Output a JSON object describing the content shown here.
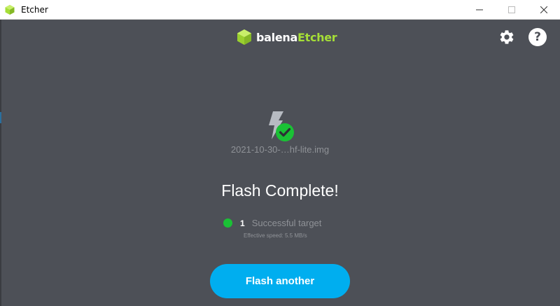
{
  "window": {
    "title": "Etcher",
    "controls": [
      "minimize-icon",
      "maximize-icon",
      "close-icon"
    ]
  },
  "header": {
    "logo_prefix": "balena",
    "logo_suffix": "Etcher",
    "settings_icon": "gear-icon",
    "help_icon": "question-icon",
    "help_glyph": "?"
  },
  "main": {
    "image_name": "2021-10-30-…hf-lite.img",
    "status_title": "Flash Complete!",
    "targets": {
      "count": "1",
      "label": "Successful target",
      "status_color": "#1ac135"
    },
    "speed": "Effective speed: 5.5 MB/s",
    "action_button": "Flash another"
  },
  "colors": {
    "background": "#4d5057",
    "accent_blue": "#00aeef",
    "brand_green": "#a5de37",
    "success_green": "#1ac135"
  }
}
